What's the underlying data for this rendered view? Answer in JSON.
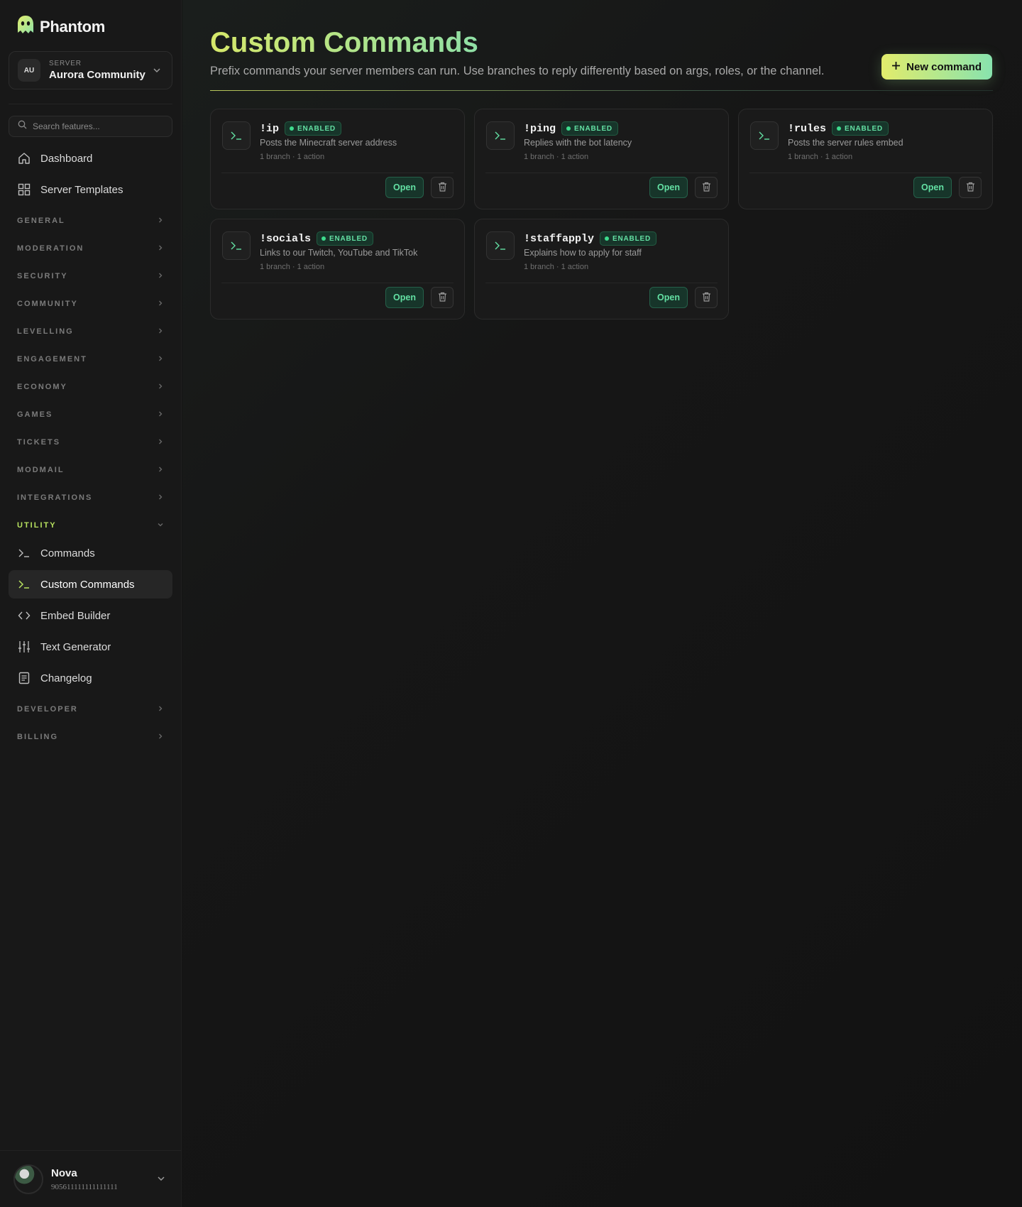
{
  "app": {
    "name": "Phantom"
  },
  "server": {
    "caption": "SERVER",
    "initials": "AU",
    "name": "Aurora Community"
  },
  "search": {
    "placeholder": "Search features..."
  },
  "nav": {
    "top": [
      {
        "label": "Dashboard",
        "icon": "home-icon"
      },
      {
        "label": "Server Templates",
        "icon": "grid-icon"
      }
    ],
    "sections": [
      "GENERAL",
      "MODERATION",
      "SECURITY",
      "COMMUNITY",
      "LEVELLING",
      "ENGAGEMENT",
      "ECONOMY",
      "GAMES",
      "TICKETS",
      "MODMAIL",
      "INTEGRATIONS"
    ],
    "open_section": "UTILITY",
    "utility_items": [
      {
        "label": "Commands",
        "icon": "terminal-icon",
        "active": false
      },
      {
        "label": "Custom Commands",
        "icon": "terminal-icon",
        "active": true
      },
      {
        "label": "Embed Builder",
        "icon": "code-icon",
        "active": false
      },
      {
        "label": "Text Generator",
        "icon": "sliders-icon",
        "active": false
      },
      {
        "label": "Changelog",
        "icon": "document-icon",
        "active": false
      }
    ],
    "sections_after": [
      "DEVELOPER",
      "BILLING"
    ]
  },
  "user": {
    "name": "Nova",
    "id": "905611111111111111"
  },
  "page": {
    "title": "Custom Commands",
    "subtitle": "Prefix commands your server members can run. Use branches to reply differently based on args, roles, or the channel.",
    "new_button": "New command"
  },
  "commands": [
    {
      "name": "!ip",
      "status": "ENABLED",
      "description": "Posts the Minecraft server address",
      "meta": "1 branch · 1 action",
      "open_label": "Open"
    },
    {
      "name": "!ping",
      "status": "ENABLED",
      "description": "Replies with the bot latency",
      "meta": "1 branch · 1 action",
      "open_label": "Open"
    },
    {
      "name": "!rules",
      "status": "ENABLED",
      "description": "Posts the server rules embed",
      "meta": "1 branch · 1 action",
      "open_label": "Open"
    },
    {
      "name": "!socials",
      "status": "ENABLED",
      "description": "Links to our Twitch, YouTube and TikTok",
      "meta": "1 branch · 1 action",
      "open_label": "Open"
    },
    {
      "name": "!staffapply",
      "status": "ENABLED",
      "description": "Explains how to apply for staff",
      "meta": "1 branch · 1 action",
      "open_label": "Open"
    }
  ],
  "colors": {
    "accent": "#b6e05f",
    "enabled": "#3ddc8d",
    "gradient_start": "#e2ec6c",
    "gradient_end": "#88e3ae"
  }
}
